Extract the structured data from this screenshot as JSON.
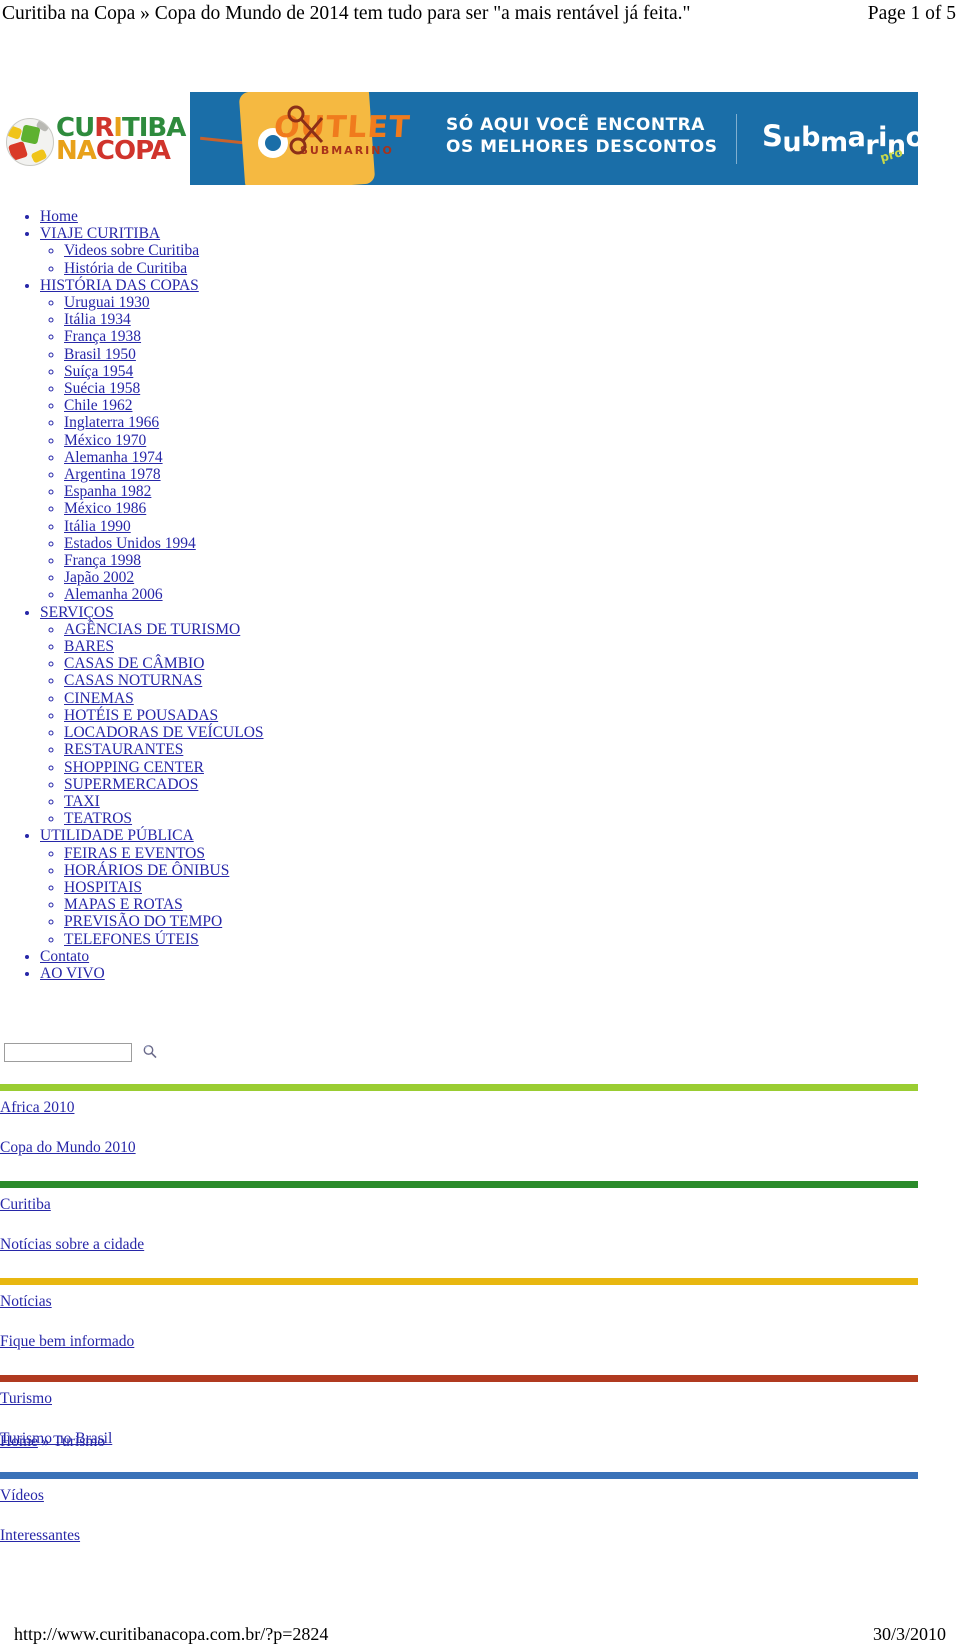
{
  "print_header": {
    "title": "Curitiba na Copa » Copa do Mundo de 2014 tem tudo para ser \"a mais rentável já feita.\"",
    "page_indicator": "Page 1 of 5"
  },
  "logo": {
    "line1_parts": [
      "C",
      "U",
      "R",
      "I",
      "T",
      "I",
      "B",
      "A"
    ],
    "line1": "CURITIBA",
    "na": "NA",
    "copa": "COPA",
    "ball_icon": "soccer-ball-icon"
  },
  "ad_banner": {
    "tag_word": "OUTLET",
    "tag_sub": "SUBMARINO",
    "copy_line1": "SÓ AQUI VOCÊ ENCONTRA",
    "copy_line2": "OS MELHORES DESCONTOS",
    "brand": "Submarino",
    "brand_suffix": "pro",
    "bg_color": "#1a6ea8",
    "tag_color": "#f5b941"
  },
  "nav": {
    "items": [
      {
        "label": "Home",
        "children": []
      },
      {
        "label": "VIAJE CURITIBA",
        "children": [
          {
            "label": "Videos sobre Curitiba"
          },
          {
            "label": "História de Curitiba"
          }
        ]
      },
      {
        "label": "HISTÓRIA DAS COPAS",
        "children": [
          {
            "label": "Uruguai 1930"
          },
          {
            "label": "Itália 1934"
          },
          {
            "label": "França 1938"
          },
          {
            "label": "Brasil 1950"
          },
          {
            "label": "Suíça 1954"
          },
          {
            "label": "Suécia 1958"
          },
          {
            "label": "Chile 1962"
          },
          {
            "label": "Inglaterra 1966"
          },
          {
            "label": "México 1970"
          },
          {
            "label": "Alemanha 1974"
          },
          {
            "label": "Argentina 1978"
          },
          {
            "label": "Espanha 1982"
          },
          {
            "label": "México 1986"
          },
          {
            "label": "Itália 1990"
          },
          {
            "label": "Estados Unidos 1994"
          },
          {
            "label": "França 1998"
          },
          {
            "label": "Japão 2002"
          },
          {
            "label": "Alemanha 2006"
          }
        ]
      },
      {
        "label": "SERVIÇOS",
        "children": [
          {
            "label": "AGÊNCIAS DE TURISMO"
          },
          {
            "label": "BARES"
          },
          {
            "label": "CASAS DE CÂMBIO"
          },
          {
            "label": "CASAS NOTURNAS"
          },
          {
            "label": "CINEMAS"
          },
          {
            "label": "HOTÉIS E POUSADAS"
          },
          {
            "label": "LOCADORAS DE VEÍCULOS"
          },
          {
            "label": "RESTAURANTES"
          },
          {
            "label": "SHOPPING CENTER"
          },
          {
            "label": "SUPERMERCADOS"
          },
          {
            "label": "TAXI"
          },
          {
            "label": "TEATROS"
          }
        ]
      },
      {
        "label": "UTILIDADE PÚBLICA",
        "children": [
          {
            "label": "FEIRAS E EVENTOS"
          },
          {
            "label": "HORÁRIOS DE ÔNIBUS"
          },
          {
            "label": "HOSPITAIS"
          },
          {
            "label": "MAPAS E ROTAS"
          },
          {
            "label": "PREVISÃO DO TEMPO"
          },
          {
            "label": "TELEFONES ÚTEIS"
          }
        ]
      },
      {
        "label": "Contato",
        "children": []
      },
      {
        "label": "AO VIVO",
        "children": []
      }
    ]
  },
  "search": {
    "value": "",
    "placeholder": "",
    "icon": "magnifier-icon"
  },
  "widgets": [
    {
      "bar_color": "#9acd32",
      "title": "Africa 2010",
      "subtitle": "Copa do Mundo 2010"
    },
    {
      "bar_color": "#2a8b2a",
      "title": "Curitiba",
      "subtitle": "Notícias sobre a cidade"
    },
    {
      "bar_color": "#e8b710",
      "title": "Notícias",
      "subtitle": "Fique bem informado"
    },
    {
      "bar_color": "#b03a20",
      "title": "Turismo",
      "subtitle": "Turismo no Brasil"
    },
    {
      "bar_color": "#3a72b8",
      "title": "Vídeos",
      "subtitle": "Interessantes"
    }
  ],
  "breadcrumb": {
    "home": "Home",
    "separator": "»",
    "current": "Turismo"
  },
  "print_footer": {
    "url": "http://www.curitibanacopa.com.br/?p=2824",
    "date": "30/3/2010"
  }
}
